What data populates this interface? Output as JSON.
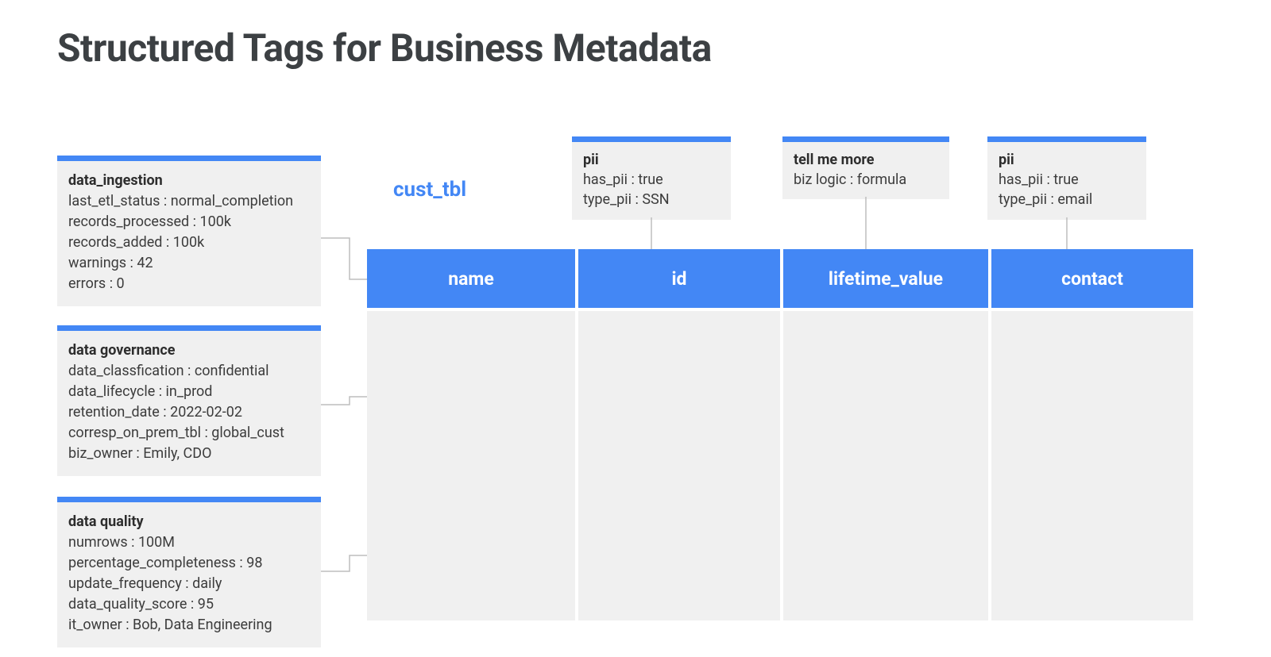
{
  "title": "Structured Tags for Business Metadata",
  "table_name": "cust_tbl",
  "table_tags": {
    "ingestion": {
      "title": "data_ingestion",
      "rows": [
        "last_etl_status : normal_completion",
        "records_processed : 100k",
        "records_added : 100k",
        "warnings : 42",
        "errors : 0"
      ]
    },
    "governance": {
      "title": "data governance",
      "rows": [
        "data_classfication : confidential",
        "data_lifecycle : in_prod",
        "retention_date : 2022-02-02",
        "corresp_on_prem_tbl : global_cust",
        "biz_owner : Emily, CDO"
      ]
    },
    "quality": {
      "title": "data quality",
      "rows": [
        "numrows : 100M",
        "percentage_completeness : 98",
        "update_frequency : daily",
        "data_quality_score : 95",
        "it_owner : Bob, Data Engineering"
      ]
    }
  },
  "columns": {
    "name": {
      "label": "name"
    },
    "id": {
      "label": "id",
      "tag": {
        "title": "pii",
        "rows": [
          "has_pii : true",
          "type_pii : SSN"
        ]
      }
    },
    "lifetime_value": {
      "label": "lifetime_value",
      "tag": {
        "title": "tell me more",
        "rows": [
          "biz logic : formula"
        ]
      }
    },
    "contact": {
      "label": "contact",
      "tag": {
        "title": "pii",
        "rows": [
          "has_pii : true",
          "type_pii : email"
        ]
      }
    }
  }
}
